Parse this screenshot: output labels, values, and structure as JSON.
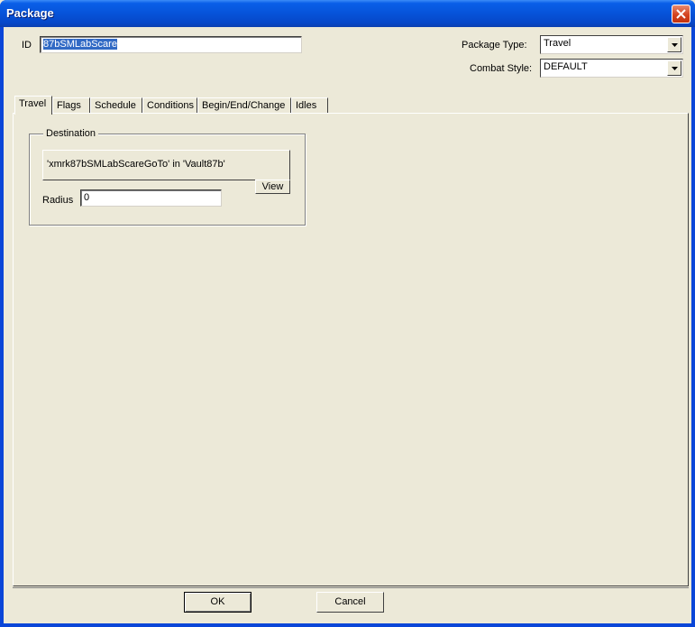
{
  "window": {
    "title": "Package"
  },
  "id_field": {
    "label": "ID",
    "value": "87bSMLabScare"
  },
  "package_type": {
    "label": "Package Type:",
    "value": "Travel"
  },
  "combat_style": {
    "label": "Combat Style:",
    "value": "DEFAULT"
  },
  "tabs": [
    {
      "label": "Travel",
      "active": true
    },
    {
      "label": "Flags"
    },
    {
      "label": "Schedule"
    },
    {
      "label": "Conditions"
    },
    {
      "label": "Begin/End/Change"
    },
    {
      "label": "Idles"
    }
  ],
  "destination": {
    "group_label": "Destination",
    "value": "'xmrk87bSMLabScareGoTo' in 'Vault87b'",
    "view_label": "View",
    "radius_label": "Radius",
    "radius_value": "0"
  },
  "footer": {
    "ok_label": "OK",
    "cancel_label": "Cancel"
  },
  "icons": {
    "close": "close-icon",
    "dropdown": "chevron-down-icon"
  }
}
